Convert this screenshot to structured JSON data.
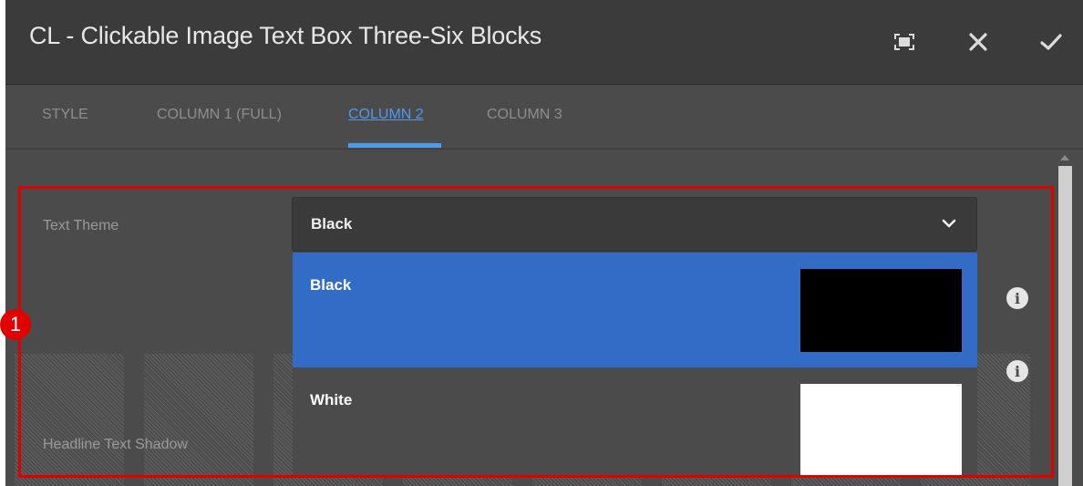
{
  "dialog": {
    "title": "CL - Clickable Image Text Box Three-Six Blocks",
    "buttons": {
      "fullscreen_icon": "fullscreen-icon",
      "close_icon": "close-icon",
      "confirm_icon": "checkmark-icon"
    }
  },
  "tabs": [
    {
      "label": "STYLE",
      "active": false
    },
    {
      "label": "COLUMN 1 (FULL)",
      "active": false
    },
    {
      "label": "COLUMN 2",
      "active": true
    },
    {
      "label": "COLUMN 3",
      "active": false
    }
  ],
  "form": {
    "text_theme": {
      "label": "Text Theme",
      "selected": "Black",
      "options": [
        {
          "label": "Black",
          "swatch": "#000000",
          "highlighted": true
        },
        {
          "label": "White",
          "swatch": "#ffffff",
          "highlighted": false
        }
      ]
    },
    "headline_text_shadow": {
      "label": "Headline Text Shadow"
    }
  },
  "annotation": {
    "callout_number": "1",
    "highlight_color": "#e00000"
  },
  "colors": {
    "accent": "#4f9bea",
    "highlight_row": "#326cc6"
  }
}
